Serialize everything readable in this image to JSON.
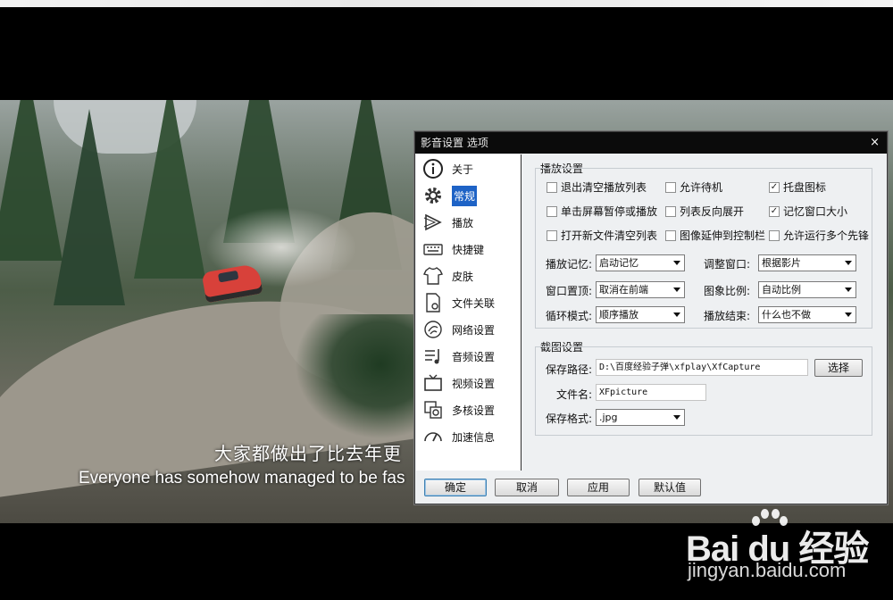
{
  "video": {
    "subtitle_cn": "大家都做出了比去年更",
    "subtitle_en": "Everyone has somehow managed to be fas"
  },
  "watermark": {
    "logo_text": "Bai du 经验",
    "url": "jingyan.baidu.com"
  },
  "dialog": {
    "title": "影音设置 选项",
    "close": "×",
    "sidebar": [
      {
        "label": "关于",
        "icon": "info-icon",
        "active": false
      },
      {
        "label": "常规",
        "icon": "gear-icon",
        "active": true
      },
      {
        "label": "播放",
        "icon": "play-icon",
        "active": false
      },
      {
        "label": "快捷键",
        "icon": "keyboard-icon",
        "active": false
      },
      {
        "label": "皮肤",
        "icon": "shirt-icon",
        "active": false
      },
      {
        "label": "文件关联",
        "icon": "file-link-icon",
        "active": false
      },
      {
        "label": "网络设置",
        "icon": "network-icon",
        "active": false
      },
      {
        "label": "音频设置",
        "icon": "audio-icon",
        "active": false
      },
      {
        "label": "视频设置",
        "icon": "tv-icon",
        "active": false
      },
      {
        "label": "多核设置",
        "icon": "multicore-icon",
        "active": false
      },
      {
        "label": "加速信息",
        "icon": "speedometer-icon",
        "active": false
      }
    ],
    "playback": {
      "title": "播放设置",
      "checkboxes": [
        {
          "label": "退出清空播放列表",
          "checked": false
        },
        {
          "label": "允许待机",
          "checked": false
        },
        {
          "label": "托盘图标",
          "checked": true
        },
        {
          "label": "单击屏幕暂停或播放",
          "checked": false
        },
        {
          "label": "列表反向展开",
          "checked": false
        },
        {
          "label": "记忆窗口大小",
          "checked": true
        },
        {
          "label": "打开新文件清空列表",
          "checked": false
        },
        {
          "label": "图像延伸到控制栏",
          "checked": false
        },
        {
          "label": "允许运行多个先锋",
          "checked": false
        }
      ],
      "play_memory_label": "播放记忆:",
      "play_memory_value": "启动记忆",
      "adjust_window_label": "调整窗口:",
      "adjust_window_value": "根据影片",
      "window_top_label": "窗口置顶:",
      "window_top_value": "取消在前端",
      "aspect_label": "图象比例:",
      "aspect_value": "自动比例",
      "loop_label": "循环模式:",
      "loop_value": "顺序播放",
      "end_label": "播放结束:",
      "end_value": "什么也不做"
    },
    "capture": {
      "title": "截图设置",
      "path_label": "保存路径:",
      "path_value": "D:\\百度经验子弹\\xfplay\\XfCapture",
      "browse_label": "选择",
      "filename_label": "文件名:",
      "filename_value": "XFpicture",
      "format_label": "保存格式:",
      "format_value": ".jpg"
    },
    "buttons": {
      "ok": "确定",
      "cancel": "取消",
      "apply": "应用",
      "default": "默认值"
    }
  }
}
